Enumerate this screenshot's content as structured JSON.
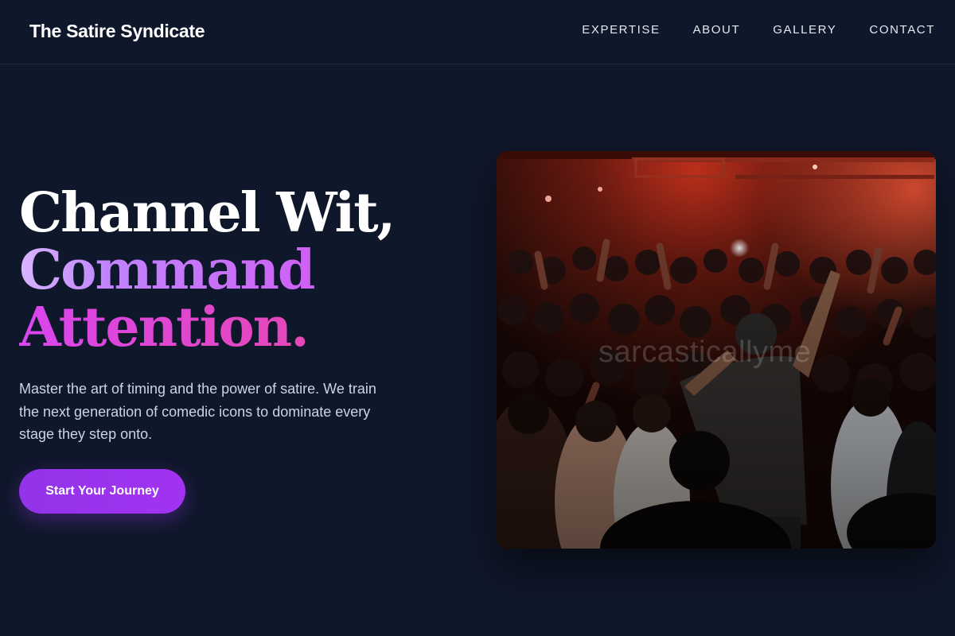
{
  "header": {
    "brand": "The Satire Syndicate",
    "nav": [
      {
        "label": "EXPERTISE"
      },
      {
        "label": "ABOUT"
      },
      {
        "label": "GALLERY"
      },
      {
        "label": "CONTACT"
      }
    ]
  },
  "hero": {
    "title_line1": "Channel Wit,",
    "title_line2": "Command",
    "title_line3": "Attention.",
    "description": "Master the art of timing and the power of satire. We train the next generation of comedic icons to dominate every stage they step onto.",
    "cta_label": "Start Your Journey",
    "image_watermark": "sarcasticallyme"
  },
  "colors": {
    "background": "#0f172a",
    "accent_purple": "#9333ea",
    "gradient_start": "#c084fc",
    "gradient_end": "#ec4899"
  },
  "icons": {
    "hero_image": "concert-crowd-photo"
  }
}
